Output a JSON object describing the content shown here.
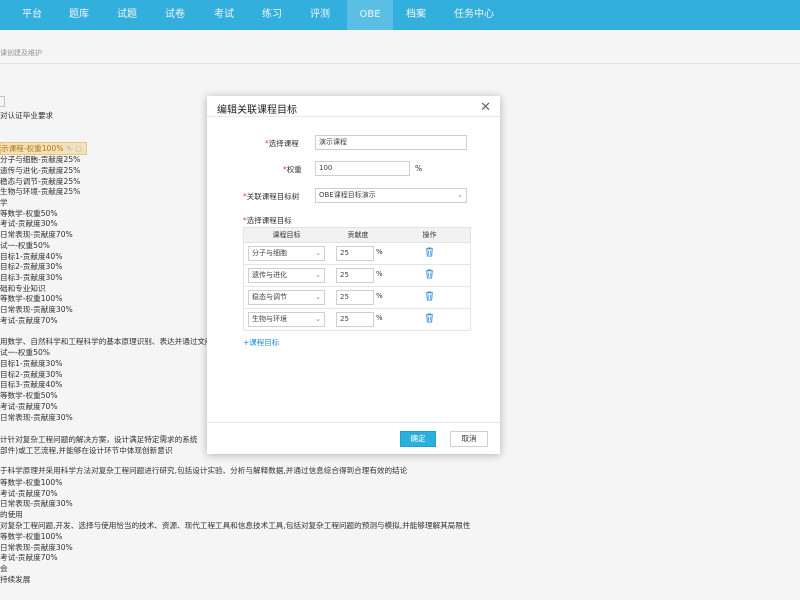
{
  "nav": {
    "tabs": [
      "平台",
      "题库",
      "试题",
      "试卷",
      "考试",
      "练习",
      "评测",
      "OBE",
      "档案",
      "任务中心"
    ],
    "active": "OBE"
  },
  "page": {
    "subtitle": "课创建及维护"
  },
  "tree": [
    "对认证毕业要求",
    "示课程-权重100%",
    "分子与细胞-贡献度25%",
    "遗传与进化-贡献度25%",
    "稳态与调节-贡献度25%",
    "生物与环境-贡献度25%",
    "学",
    "等数学-权重50%",
    "考试-贡献度30%",
    "日常表现-贡献度70%",
    "试一-权重50%",
    "目标1-贡献度40%",
    "目标2-贡献度30%",
    "目标3-贡献度30%",
    "础和专业知识",
    "等数学-权重100%",
    "日常表现-贡献度30%",
    "考试-贡献度70%",
    "用数学、自然科学和工程科学的基本原理识别、表达并通过文献",
    "试一-权重50%",
    "目标1-贡献度30%",
    "目标2-贡献度30%",
    "目标3-贡献度40%",
    "等数学-权重50%",
    "考试-贡献度70%",
    "日常表现-贡献度30%",
    "计针对复杂工程问题的解决方案，设计满足特定需求的系统",
    "部件)或工艺流程,并能够在设计环节中体现创新意识",
    "于科学原理并采用科学方法对复杂工程问题进行研究,包括设计实验、分析与解释数据,并通过信息综合得到合理有效的结论",
    "等数学-权重100%",
    "考试-贡献度70%",
    "日常表现-贡献度30%",
    "的使用",
    "对复杂工程问题,开发、选择与使用恰当的技术、资源、现代工程工具和信息技术工具,包括对复杂工程问题的预测与模拟,并能够理解其局限性",
    "等数学-权重100%",
    "日常表现-贡献度30%",
    "考试-贡献度70%",
    "会",
    "持续发展"
  ],
  "dialog": {
    "title": "编辑关联课程目标",
    "select_course_label": "选择课程",
    "course_value": "演示课程",
    "weight_label": "权重",
    "weight_value": "100",
    "weight_unit": "%",
    "tree_label": "关联课程目标树",
    "tree_value": "OBE课程目标演示",
    "pick_label": "选择课程目标",
    "columns": [
      "课程目标",
      "贡献度",
      "操作"
    ],
    "rows": [
      {
        "target": "分子与细胞",
        "contribution": "25",
        "unit": "%"
      },
      {
        "target": "遗传与进化",
        "contribution": "25",
        "unit": "%"
      },
      {
        "target": "稳态与调节",
        "contribution": "25",
        "unit": "%"
      },
      {
        "target": "生物与环境",
        "contribution": "25",
        "unit": "%"
      }
    ],
    "add_label": "+课程目标",
    "confirm_label": "确定",
    "cancel_label": "取消"
  },
  "colors": {
    "nav_bg": "#35b7e6",
    "primary": "#29b0dd",
    "highlight": "#fcebc7"
  }
}
